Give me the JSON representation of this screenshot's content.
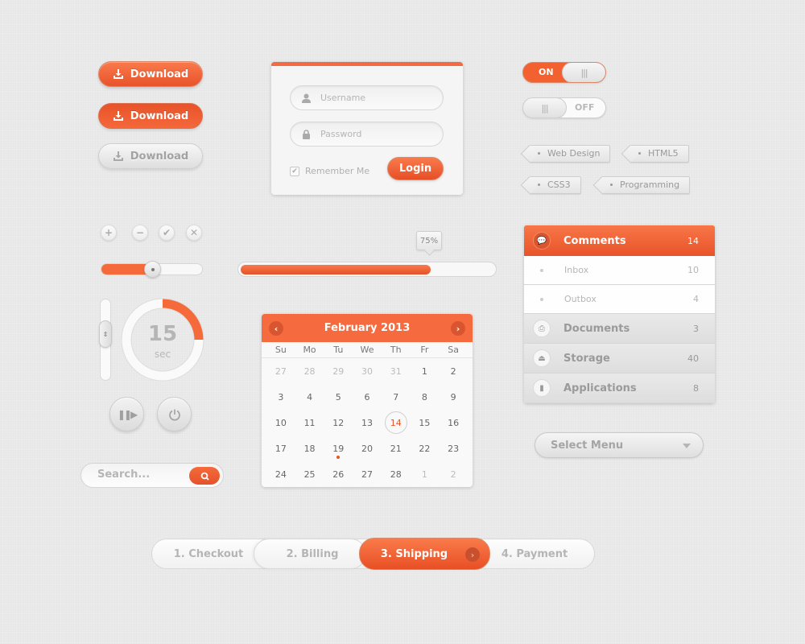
{
  "download_buttons": [
    {
      "label": "Download",
      "state": "default",
      "icon": "download-icon"
    },
    {
      "label": "Download",
      "state": "pressed",
      "icon": "download-icon"
    },
    {
      "label": "Download",
      "state": "disabled",
      "icon": "download-icon"
    }
  ],
  "login": {
    "username_placeholder": "Username",
    "password_placeholder": "Password",
    "remember_label": "Remember Me",
    "remember_checked": true,
    "login_label": "Login"
  },
  "toggles": {
    "on_label": "ON",
    "off_label": "OFF",
    "grip": "|||"
  },
  "tags": [
    "Web Design",
    "HTML5",
    "CSS3",
    "Programming"
  ],
  "mini_buttons": [
    {
      "name": "plus",
      "glyph": "+"
    },
    {
      "name": "minus",
      "glyph": "−"
    },
    {
      "name": "check",
      "glyph": "✔"
    },
    {
      "name": "close",
      "glyph": "✕"
    }
  ],
  "hslider": {
    "value_percent": 50
  },
  "progress": {
    "value_percent": 75,
    "label": "75%"
  },
  "vslider": {
    "value_percent": 60,
    "grip": "⇕"
  },
  "timer": {
    "value": "15",
    "unit": "sec",
    "fraction": 0.25
  },
  "media_buttons": [
    {
      "name": "play-pause",
      "glyph": "❚❚▶"
    },
    {
      "name": "power",
      "glyph": "⏻"
    }
  ],
  "search": {
    "placeholder": "Search..."
  },
  "calendar": {
    "title": "February 2013",
    "prev": "‹",
    "next": "›",
    "weekdays": [
      "Su",
      "Mo",
      "Tu",
      "We",
      "Th",
      "Fr",
      "Sa"
    ],
    "weeks": [
      [
        {
          "d": "27",
          "m": true
        },
        {
          "d": "28",
          "m": true
        },
        {
          "d": "29",
          "m": true
        },
        {
          "d": "30",
          "m": true
        },
        {
          "d": "31",
          "m": true
        },
        {
          "d": "1"
        },
        {
          "d": "2"
        }
      ],
      [
        {
          "d": "3"
        },
        {
          "d": "4"
        },
        {
          "d": "5"
        },
        {
          "d": "6"
        },
        {
          "d": "7"
        },
        {
          "d": "8"
        },
        {
          "d": "9"
        }
      ],
      [
        {
          "d": "10"
        },
        {
          "d": "11"
        },
        {
          "d": "12"
        },
        {
          "d": "13"
        },
        {
          "d": "14",
          "today": true
        },
        {
          "d": "15"
        },
        {
          "d": "16"
        }
      ],
      [
        {
          "d": "17"
        },
        {
          "d": "18"
        },
        {
          "d": "19",
          "event": true
        },
        {
          "d": "20"
        },
        {
          "d": "21"
        },
        {
          "d": "22"
        },
        {
          "d": "23"
        }
      ],
      [
        {
          "d": "24"
        },
        {
          "d": "25"
        },
        {
          "d": "26"
        },
        {
          "d": "27"
        },
        {
          "d": "28"
        },
        {
          "d": "1",
          "m": true
        },
        {
          "d": "2",
          "m": true
        }
      ]
    ]
  },
  "menu": {
    "items": [
      {
        "label": "Comments",
        "count": "14",
        "type": "main",
        "active": true,
        "icon": "comments-icon",
        "glyph": "💬"
      },
      {
        "label": "Inbox",
        "count": "10",
        "type": "sub"
      },
      {
        "label": "Outbox",
        "count": "4",
        "type": "sub"
      },
      {
        "label": "Documents",
        "count": "3",
        "type": "main",
        "icon": "printer-icon",
        "glyph": "⎙"
      },
      {
        "label": "Storage",
        "count": "40",
        "type": "main",
        "icon": "inbox-tray-icon",
        "glyph": "⏏"
      },
      {
        "label": "Applications",
        "count": "8",
        "type": "main",
        "icon": "door-icon",
        "glyph": "▮"
      }
    ]
  },
  "select": {
    "label": "Select Menu"
  },
  "steps": [
    {
      "label": "1. Checkout"
    },
    {
      "label": "2. Billing"
    },
    {
      "label": "3. Shipping",
      "active": true
    },
    {
      "label": "4. Payment"
    }
  ],
  "colors": {
    "accent": "#f46b3f",
    "accent_dark": "#e9532a",
    "background": "#ebebeb"
  }
}
